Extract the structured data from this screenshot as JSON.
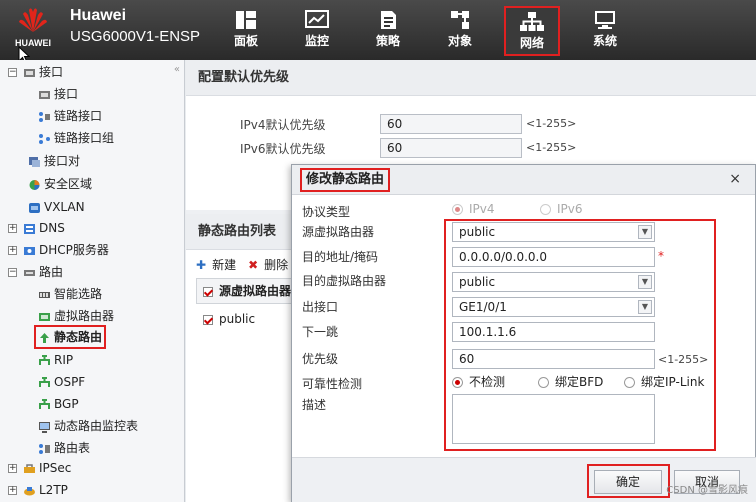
{
  "header": {
    "logo_text": "HUAWEI",
    "brand_line1": "Huawei",
    "brand_line2": "USG6000V1-ENSP",
    "nav": [
      {
        "label": "面板",
        "icon": "dashboard-icon"
      },
      {
        "label": "监控",
        "icon": "monitor-icon"
      },
      {
        "label": "策略",
        "icon": "policy-icon"
      },
      {
        "label": "对象",
        "icon": "object-icon"
      },
      {
        "label": "网络",
        "icon": "network-icon",
        "active": true
      },
      {
        "label": "系统",
        "icon": "system-icon"
      }
    ]
  },
  "sidebar": {
    "collapse": "«",
    "items": [
      {
        "label": "接口",
        "expand": "−"
      },
      {
        "label": "接口"
      },
      {
        "label": "链路接口"
      },
      {
        "label": "链路接口组"
      },
      {
        "label": "接口对"
      },
      {
        "label": "安全区域"
      },
      {
        "label": "VXLAN"
      },
      {
        "label": "DNS",
        "expand": "+"
      },
      {
        "label": "DHCP服务器",
        "expand": "+"
      },
      {
        "label": "路由",
        "expand": "−"
      },
      {
        "label": "智能选路"
      },
      {
        "label": "虚拟路由器"
      },
      {
        "label": "静态路由",
        "selected": true
      },
      {
        "label": "RIP"
      },
      {
        "label": "OSPF"
      },
      {
        "label": "BGP"
      },
      {
        "label": "动态路由监控表"
      },
      {
        "label": "路由表"
      },
      {
        "label": "IPSec",
        "expand": "+"
      },
      {
        "label": "L2TP",
        "expand": "+"
      }
    ]
  },
  "default_priority": {
    "title": "配置默认优先级",
    "ipv4_label": "IPv4默认优先级",
    "ipv4_value": "60",
    "ipv6_label": "IPv6默认优先级",
    "ipv6_value": "60",
    "range": "<1-255>"
  },
  "route_list": {
    "title": "静态路由列表",
    "new_label": "新建",
    "delete_label": "删除",
    "col_header": "源虚拟路由器",
    "row1": "public"
  },
  "dialog": {
    "title": "修改静态路由",
    "close": "×",
    "protocol_label": "协议类型",
    "ipv4": "IPv4",
    "ipv6": "IPv6",
    "src_vr_label": "源虚拟路由器",
    "src_vr_value": "public",
    "dest_label": "目的地址/掩码",
    "dest_value": "0.0.0.0/0.0.0.0",
    "required": "*",
    "dest_vr_label": "目的虚拟路由器",
    "dest_vr_value": "public",
    "out_if_label": "出接口",
    "out_if_value": "GE1/0/1",
    "next_hop_label": "下一跳",
    "next_hop_value": "100.1.1.6",
    "priority_label": "优先级",
    "priority_value": "60",
    "priority_range": "<1-255>",
    "reliability_label": "可靠性检测",
    "opt_none": "不检测",
    "opt_bfd": "绑定BFD",
    "opt_iplink": "绑定IP-Link",
    "desc_label": "描述",
    "desc_value": "",
    "ok": "确定",
    "cancel": "取消"
  },
  "watermark": "CSDN @雪影风痕"
}
